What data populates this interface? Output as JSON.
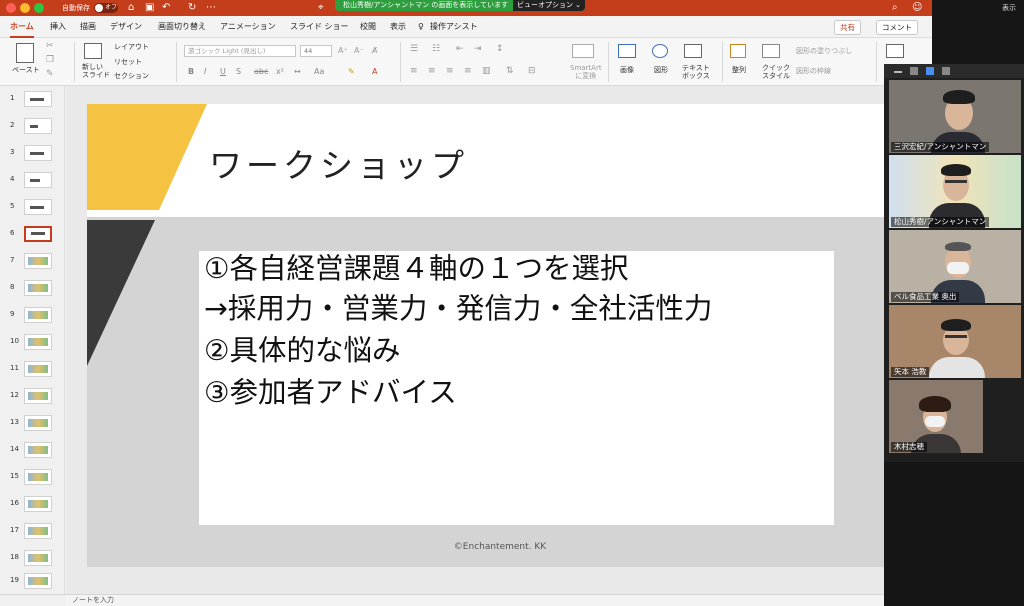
{
  "titlebar": {
    "autosave_label": "自動保存",
    "autosave_state": "オフ",
    "share_banner": "松山秀樹/アンシャントマン の画面を表示しています",
    "view_options": "ビューオプション ⌄"
  },
  "tabs": [
    "ホーム",
    "挿入",
    "描画",
    "デザイン",
    "画面切り替え",
    "アニメーション",
    "スライド ショー",
    "校閲",
    "表示"
  ],
  "tell_me": "操作アシスト",
  "share_button": "共有",
  "comment_button": "コメント",
  "ribbon": {
    "paste": "ペースト",
    "new_slide": "新しい\nスライド",
    "layout": "レイアウト",
    "reset": "リセット",
    "section": "セクション",
    "font_name": "游ゴシック Light (見出し)",
    "font_size": "44",
    "smartart": "SmartArt\nに変換",
    "picture": "画像",
    "shapes": "図形",
    "textbox": "テキスト\nボックス",
    "arrange": "整列",
    "quick_styles": "クイック\nスタイル",
    "shape_fill": "図形の塗りつぶし",
    "shape_outline": "図形の枠線"
  },
  "thumbnails": [
    "1",
    "2",
    "3",
    "4",
    "5",
    "6",
    "7",
    "8",
    "9",
    "10",
    "11",
    "12",
    "13",
    "14",
    "15",
    "16",
    "17",
    "18",
    "19"
  ],
  "selected_slide": 6,
  "slide": {
    "title": "ワークショップ",
    "body_lines": [
      "①各自経営課題４軸の１つを選択",
      "→採用力・営業力・発信力・全社活性力",
      "②具体的な悩み",
      "③参加者アドバイス"
    ],
    "copyright": "©Enchantement. KK",
    "colors": {
      "accent_yellow": "#f5c242",
      "dark_gray": "#3a3a3a",
      "light_gray": "#d4d4d4"
    }
  },
  "notes_placeholder": "ノートを入力",
  "zoom": {
    "top_right_label": "表示",
    "participants": [
      {
        "name": "三沢宏紀/アンシャントマン"
      },
      {
        "name": "松山秀樹/アンシャントマン"
      },
      {
        "name": "ベル食品工業 奥出"
      },
      {
        "name": "矢本 浩教"
      },
      {
        "name": "木村志穂"
      }
    ]
  },
  "colors": {
    "ppt_accent": "#c43e1c",
    "zoom_share_green": "#2f9e3f"
  }
}
